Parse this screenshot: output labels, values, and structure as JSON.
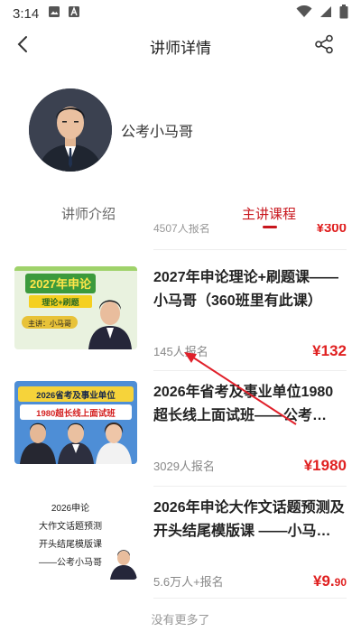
{
  "status_bar": {
    "time": "3:14",
    "icons": [
      "image-icon",
      "a-badge-icon",
      "wifi-icon",
      "signal-icon",
      "battery-icon"
    ]
  },
  "header": {
    "title": "讲师详情",
    "back_icon": "chevron-left-icon",
    "share_icon": "share-icon"
  },
  "teacher": {
    "name": "公考小马哥"
  },
  "tabs": [
    {
      "label": "讲师介绍",
      "active": false
    },
    {
      "label": "主讲课程",
      "active": true
    }
  ],
  "partial_row": {
    "enroll": "4507人报名",
    "price": "¥300"
  },
  "courses": [
    {
      "title": "2027年申论理论+刷题课——小马哥（360班里有此课）",
      "enroll": "145人报名",
      "price": "¥132",
      "thumb": {
        "headline": "2027年申论",
        "sub": "理论+刷题",
        "presenter": "主讲：小马哥"
      }
    },
    {
      "title": "2026年省考及事业单位1980超长线上面试班——公考…",
      "enroll": "3029人报名",
      "price": "¥1980",
      "thumb": {
        "headline": "2026省考及事业单位",
        "sub": "1980超长线上面试班"
      }
    },
    {
      "title": "2026年申论大作文话题预测及开头结尾模版课 ——小马…",
      "enroll": "5.6万人+报名",
      "price_main": "¥9.",
      "price_cents": "90",
      "thumb": {
        "line1": "2026申论",
        "line2": "大作文话题预测",
        "line3": "开头结尾模版课",
        "line4": "——公考小马哥"
      }
    }
  ],
  "footer": {
    "note": "没有更多了"
  },
  "colors": {
    "accent": "#c8161d",
    "price": "#e02020",
    "annotation_arrow": "#e0202a"
  }
}
